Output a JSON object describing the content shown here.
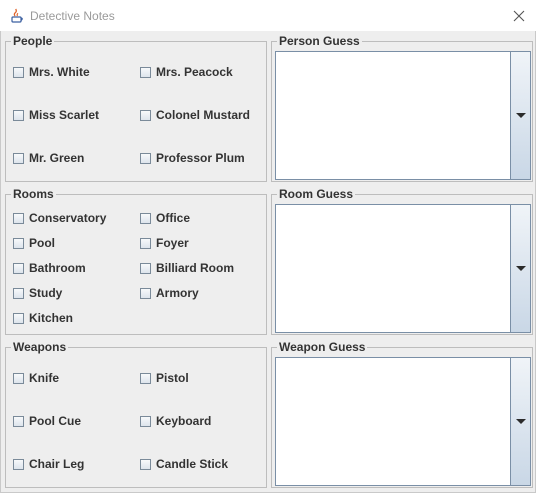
{
  "window": {
    "title": "Detective Notes",
    "close_icon": "close-icon"
  },
  "people": {
    "title": "People",
    "items": [
      "Mrs. White",
      "Mrs. Peacock",
      "Miss Scarlet",
      "Colonel Mustard",
      "Mr. Green",
      "Professor Plum"
    ]
  },
  "rooms": {
    "title": "Rooms",
    "items": [
      "Conservatory",
      "Office",
      "Pool",
      "Foyer",
      "Bathroom",
      "Billiard Room",
      "Study",
      "Armory",
      "Kitchen"
    ]
  },
  "weapons": {
    "title": "Weapons",
    "items": [
      "Knife",
      "Pistol",
      "Pool Cue",
      "Keyboard",
      "Chair Leg",
      "Candle Stick"
    ]
  },
  "person_guess": {
    "title": "Person Guess",
    "value": ""
  },
  "room_guess": {
    "title": "Room Guess",
    "value": ""
  },
  "weapon_guess": {
    "title": "Weapon Guess",
    "value": ""
  }
}
